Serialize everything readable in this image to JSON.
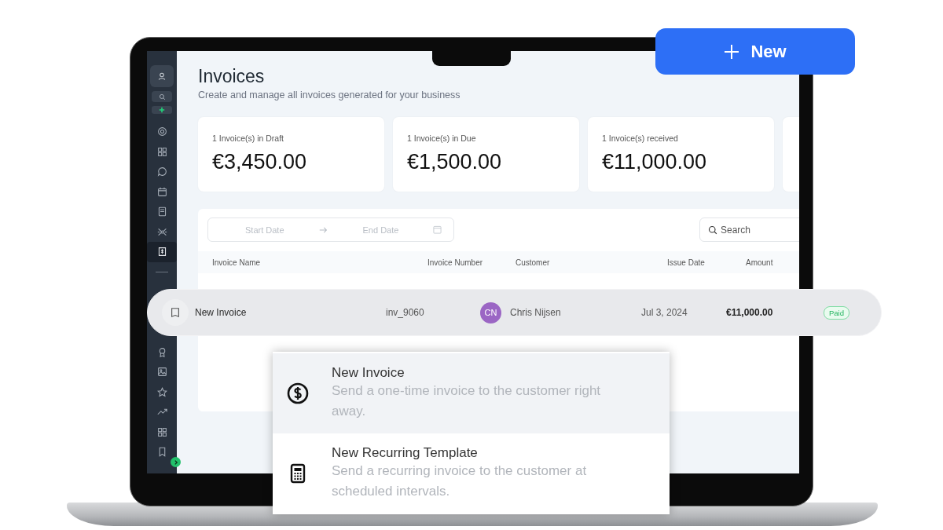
{
  "new_button": {
    "label": "New"
  },
  "sidebar": {
    "top_items": [
      {
        "selected": false
      },
      {
        "selected": false
      },
      {
        "selected": false
      },
      {
        "selected": false
      },
      {
        "selected": false
      },
      {
        "selected": false
      },
      {
        "selected": true
      }
    ],
    "bottom_items": [
      {
        "selected": false
      },
      {
        "selected": false
      },
      {
        "selected": false
      },
      {
        "selected": false
      },
      {
        "selected": false
      },
      {
        "selected": false
      }
    ]
  },
  "header": {
    "title": "Invoices",
    "subtitle": "Create and manage all invoices generated for your business"
  },
  "stats": [
    {
      "label": "1 Invoice(s) in Draft",
      "value": "€3,450.00"
    },
    {
      "label": "1 Invoice(s) in Due",
      "value": "€1,500.00"
    },
    {
      "label": "1 Invoice(s) received",
      "value": "€11,000.00"
    }
  ],
  "filters": {
    "date_range": {
      "start_placeholder": "Start Date",
      "end_placeholder": "End Date"
    },
    "search": {
      "placeholder": "Search"
    }
  },
  "table": {
    "columns": [
      "Invoice Name",
      "Invoice Number",
      "Customer",
      "Issue Date",
      "Amount"
    ],
    "rows": [
      {
        "name": "New Invoice",
        "number": "inv_9060",
        "customer_initials": "CN",
        "customer": "Chris Nijsen",
        "issue_date": "Jul 3, 2024",
        "amount": "€11,000.00",
        "status": "Paid"
      }
    ]
  },
  "menu": {
    "items": [
      {
        "kind": "one-time",
        "title": "New Invoice",
        "description": "Send a one-time invoice to the customer right away.",
        "selected": true
      },
      {
        "kind": "recurring",
        "title": "New Recurring Template",
        "description": "Send a recurring invoice to the customer at scheduled intervals.",
        "selected": false
      }
    ]
  }
}
